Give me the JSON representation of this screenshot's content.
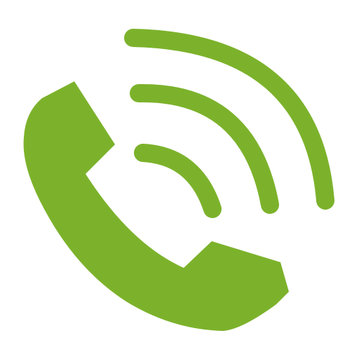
{
  "icon": {
    "name": "phone-call-icon",
    "color": "#7cb22b",
    "background": "#ffffff"
  }
}
